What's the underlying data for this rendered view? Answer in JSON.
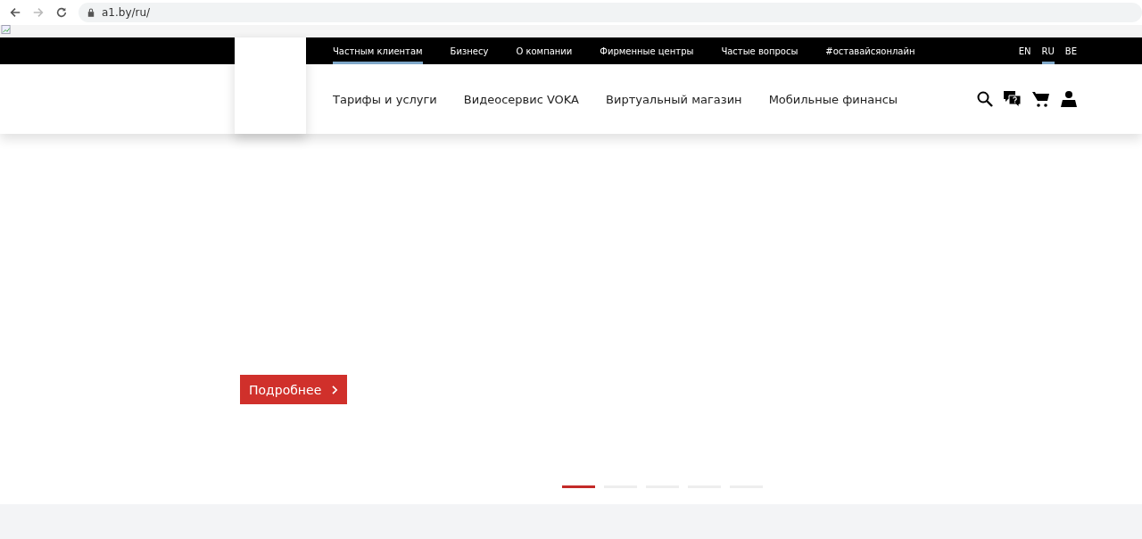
{
  "browser": {
    "url": "a1.by/ru/"
  },
  "top_nav": [
    {
      "label": "Частным клиентам",
      "selected": true
    },
    {
      "label": "Бизнесу",
      "selected": false
    },
    {
      "label": "О компании",
      "selected": false
    },
    {
      "label": "Фирменные центры",
      "selected": false
    },
    {
      "label": "Частые вопросы",
      "selected": false
    },
    {
      "label": "#оставайсяонлайн",
      "selected": false
    }
  ],
  "languages": [
    {
      "label": "EN",
      "selected": false
    },
    {
      "label": "RU",
      "selected": true
    },
    {
      "label": "BE",
      "selected": false
    }
  ],
  "main_nav": [
    "Тарифы и услуги",
    "Видеосервис VOKA",
    "Виртуальный магазин",
    "Мобильные финансы"
  ],
  "hero": {
    "button": "Подробнее"
  },
  "slides": [
    {
      "selected": true
    },
    {
      "selected": false
    },
    {
      "selected": false
    },
    {
      "selected": false
    },
    {
      "selected": false
    }
  ]
}
